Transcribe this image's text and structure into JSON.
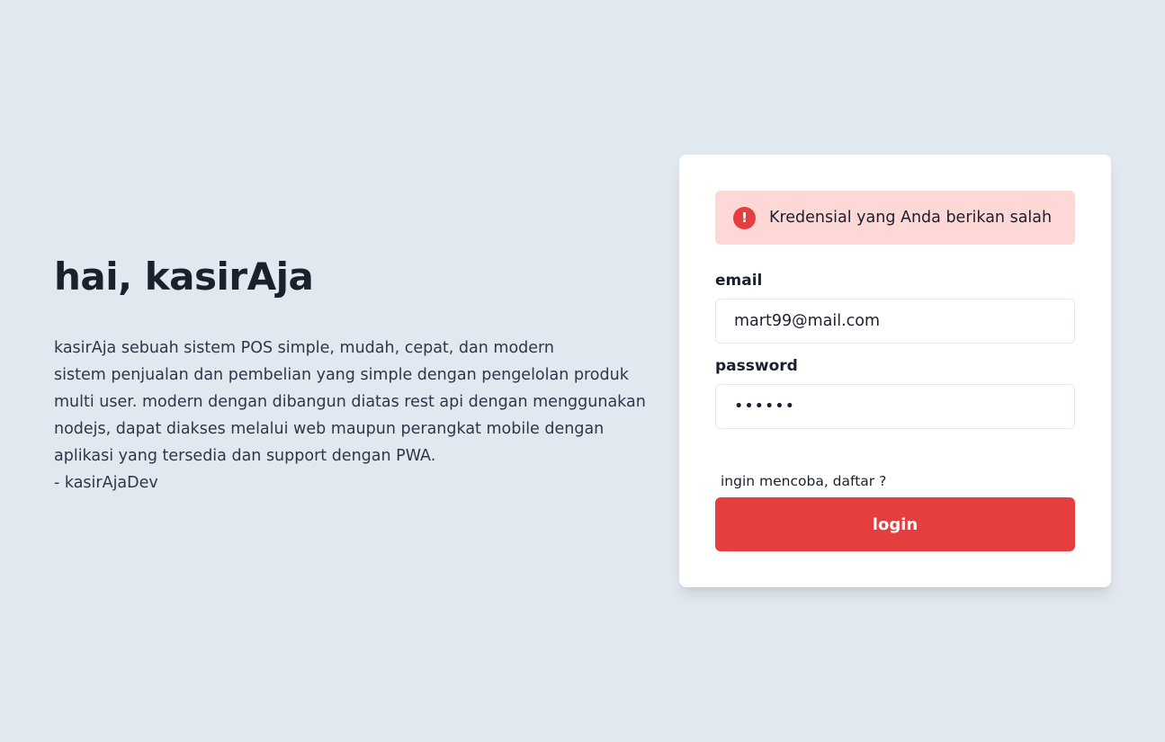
{
  "hero": {
    "title": "hai, kasirAja",
    "description_lines": [
      "kasirAja sebuah sistem POS simple, mudah, cepat, dan modern",
      "sistem penjualan dan pembelian yang simple dengan pengelolan produk",
      "multi user. modern dengan dibangun diatas rest api dengan menggunakan",
      "nodejs, dapat diakses melalui web maupun perangkat mobile dengan",
      "aplikasi yang tersedia dan support dengan PWA.",
      "- kasirAjaDev"
    ]
  },
  "login_form": {
    "alert": {
      "icon": "exclamation-circle-icon",
      "message": "Kredensial yang Anda berikan salah",
      "color": "#e53e3e",
      "background": "#fed7d7"
    },
    "email": {
      "label": "email",
      "value": "mart99@mail.com"
    },
    "password": {
      "label": "password",
      "value": "••••••"
    },
    "signup_link": "ingin mencoba, daftar ?",
    "login_button": "login",
    "accent_color": "#e53e3e"
  },
  "colors": {
    "page_background": "#e2e8f0",
    "card_background": "#ffffff"
  }
}
